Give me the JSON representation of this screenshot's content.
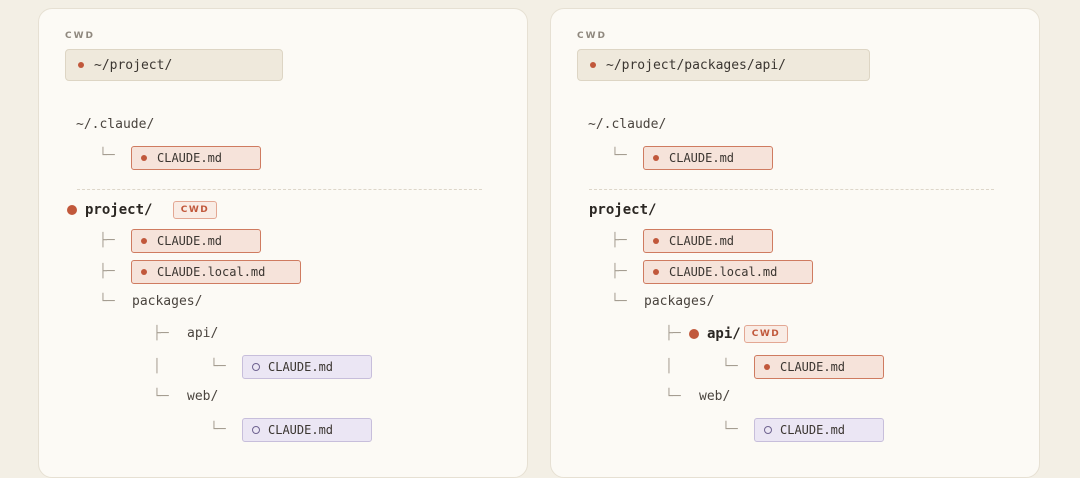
{
  "left": {
    "cwd_label": "CWD",
    "cwd_path": "~/project/",
    "home_dir": "~/.claude/",
    "home_file": "CLAUDE.md",
    "project_dir": "project/",
    "cwd_badge": "CWD",
    "project_file_1": "CLAUDE.md",
    "project_file_2": "CLAUDE.local.md",
    "packages_dir": "packages/",
    "api_dir": "api/",
    "api_file": "CLAUDE.md",
    "web_dir": "web/",
    "web_file": "CLAUDE.md"
  },
  "right": {
    "cwd_label": "CWD",
    "cwd_path": "~/project/packages/api/",
    "home_dir": "~/.claude/",
    "home_file": "CLAUDE.md",
    "project_dir": "project/",
    "project_file_1": "CLAUDE.md",
    "project_file_2": "CLAUDE.local.md",
    "packages_dir": "packages/",
    "api_dir": "api/",
    "cwd_badge": "CWD",
    "api_file": "CLAUDE.md",
    "web_dir": "web/",
    "web_file": "CLAUDE.md"
  },
  "glyphs": {
    "tee": "├─",
    "corner": "└─",
    "pipe": "│"
  },
  "colors": {
    "accent": "#c1583b",
    "loaded_file_bg": "#f6e3da",
    "unloaded_file_bg": "#ebe6f4"
  }
}
